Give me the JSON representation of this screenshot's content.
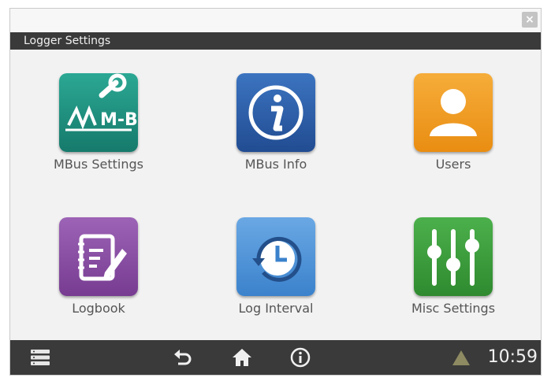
{
  "window": {
    "title": "Logger Settings",
    "close_glyph": "×"
  },
  "tiles": [
    {
      "id": "mbus-settings",
      "label": "MBus Settings",
      "icon": "mbus-wrench-icon",
      "color": "#1f8f7e",
      "icon_text": "M-Bus"
    },
    {
      "id": "mbus-info",
      "label": "MBus Info",
      "icon": "info-icon",
      "color": "#2d5fa8"
    },
    {
      "id": "users",
      "label": "Users",
      "icon": "user-icon",
      "color": "#f29b1d"
    },
    {
      "id": "logbook",
      "label": "Logbook",
      "icon": "notebook-pen-icon",
      "color": "#8b4fa3"
    },
    {
      "id": "log-interval",
      "label": "Log Interval",
      "icon": "clock-history-icon",
      "color": "#4d92d6"
    },
    {
      "id": "misc-settings",
      "label": "Misc Settings",
      "icon": "sliders-icon",
      "color": "#3a9a3a"
    }
  ],
  "taskbar": {
    "icons": [
      "menu-icon",
      "back-icon",
      "home-icon",
      "info-icon",
      "warning-icon"
    ],
    "clock": "10:59"
  }
}
